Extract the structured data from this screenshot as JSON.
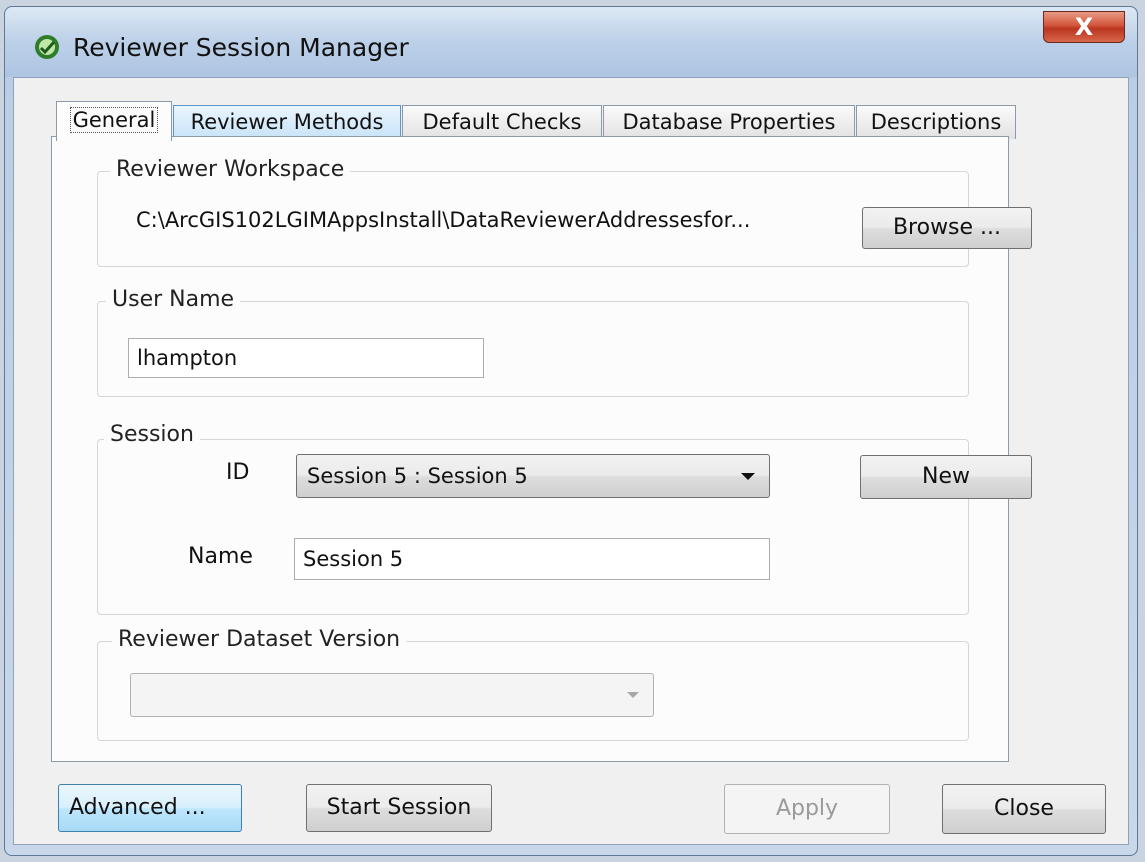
{
  "window": {
    "title": "Reviewer Session Manager",
    "close_symbol": "X"
  },
  "tabs": [
    {
      "label": "General",
      "active": true
    },
    {
      "label": "Reviewer Methods",
      "active": false
    },
    {
      "label": "Default Checks",
      "active": false
    },
    {
      "label": "Database Properties",
      "active": false
    },
    {
      "label": "Descriptions",
      "active": false
    }
  ],
  "workspace": {
    "legend": "Reviewer Workspace",
    "path": "C:\\ArcGIS102LGIMAppsInstall\\DataReviewerAddressesfor...",
    "browse_label": "Browse ..."
  },
  "user": {
    "legend": "User Name",
    "value": "lhampton"
  },
  "session": {
    "legend": "Session",
    "id_label": "ID",
    "id_value": "Session 5 : Session 5",
    "new_label": "New",
    "name_label": "Name",
    "name_value": "Session 5"
  },
  "dataset_version": {
    "legend": "Reviewer Dataset Version",
    "value": ""
  },
  "footer": {
    "advanced_label": "Advanced ...",
    "start_label": "Start Session",
    "apply_label": "Apply",
    "close_label": "Close"
  },
  "colors": {
    "focus_blue": "#bee6fd",
    "close_red": "#c9442b"
  }
}
